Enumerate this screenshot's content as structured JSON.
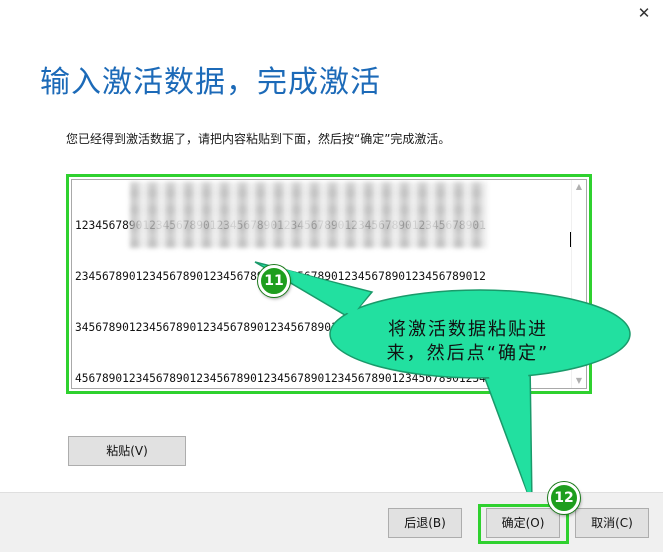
{
  "window": {
    "close_glyph": "✕"
  },
  "heading": "输入激活数据，完成激活",
  "instruction": "您已经得到激活数据了，请把内容粘贴到下面，然后按“确定”完成激活。",
  "textarea": {
    "lines": [
      "1234567890123456789012345678901234567890123456789012345678901",
      "2345678901234567890123456789012345678901234567890123456789012",
      "3456789012345678901234567890123456789012345678901234567890123",
      "4567890123456789012345678901234567890123456789012345678901234"
    ]
  },
  "annotations": {
    "badge_11": "11",
    "badge_12": "12",
    "callout_line1": "将激活数据粘贴进",
    "callout_line2": "来，然后点“确定”",
    "highlight_color": "#2fd12f",
    "callout_fill": "#22e0a0",
    "badge_color": "#1e9e1e"
  },
  "buttons": {
    "paste": "粘贴(V)",
    "back": "后退(B)",
    "ok": "确定(O)",
    "cancel": "取消(C)"
  }
}
